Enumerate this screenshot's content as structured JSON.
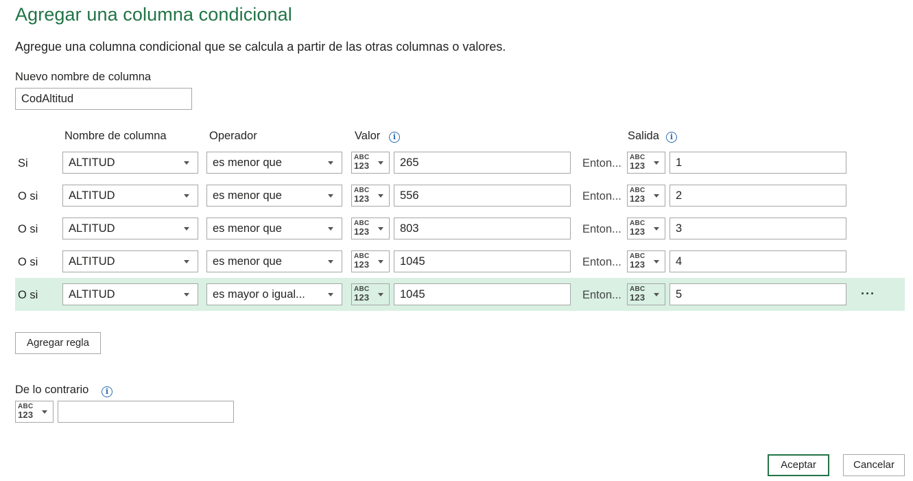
{
  "dialog": {
    "title": "Agregar una columna condicional",
    "description": "Agregue una columna condicional que se calcula a partir de las otras columnas o valores.",
    "new_column_label": "Nuevo nombre de columna",
    "new_column_value": "CodAltitud"
  },
  "headers": {
    "column_name": "Nombre de columna",
    "operator": "Operador",
    "value": "Valor",
    "output": "Salida"
  },
  "rules": [
    {
      "prefix": "Si",
      "column": "ALTITUD",
      "operator": "es menor que",
      "value": "265",
      "then": "Enton...",
      "output": "1"
    },
    {
      "prefix": "O si",
      "column": "ALTITUD",
      "operator": "es menor que",
      "value": "556",
      "then": "Enton...",
      "output": "2"
    },
    {
      "prefix": "O si",
      "column": "ALTITUD",
      "operator": "es menor que",
      "value": "803",
      "then": "Enton...",
      "output": "3"
    },
    {
      "prefix": "O si",
      "column": "ALTITUD",
      "operator": "es menor que",
      "value": "1045",
      "then": "Enton...",
      "output": "4"
    },
    {
      "prefix": "O si",
      "column": "ALTITUD",
      "operator": "es mayor o igual...",
      "value": "1045",
      "then": "Enton...",
      "output": "5"
    }
  ],
  "type_icon": {
    "top": "ABC",
    "bottom": "123"
  },
  "add_rule_label": "Agregar regla",
  "otherwise": {
    "label": "De lo contrario",
    "value": ""
  },
  "row_menu_label": "···",
  "buttons": {
    "ok": "Aceptar",
    "cancel": "Cancelar"
  },
  "colors": {
    "accent": "#217346",
    "selected_row": "#d9f0e3",
    "info": "#2b6cb0"
  }
}
